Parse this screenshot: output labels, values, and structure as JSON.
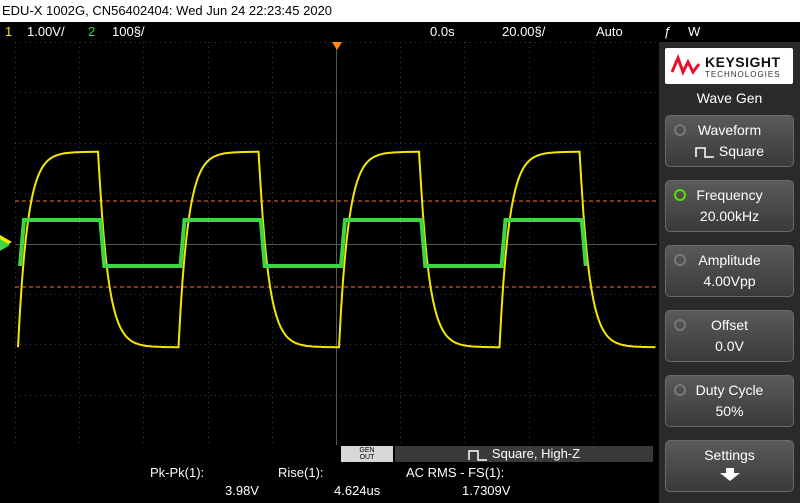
{
  "titlebar": {
    "text": "EDU-X 1002G, CN56402404: Wed Jun 24 22:23:45 2020"
  },
  "status": {
    "ch1_num": "1",
    "ch1_scale": "1.00V/",
    "ch2_num": "2",
    "ch2_scale": "100§/",
    "time_delay": "0.0s",
    "time_scale": "20.00§/",
    "trigger_mode": "Auto",
    "trigger_symbol": "ƒ",
    "trigger_source": "W"
  },
  "brand": {
    "name": "KEYSIGHT",
    "sub": "TECHNOLOGIES"
  },
  "menu": {
    "title": "Wave Gen",
    "keys": [
      {
        "label": "Waveform",
        "value": "Square",
        "active": false
      },
      {
        "label": "Frequency",
        "value": "20.00kHz",
        "active": true
      },
      {
        "label": "Amplitude",
        "value": "4.00Vpp",
        "active": false
      },
      {
        "label": "Offset",
        "value": "0.0V",
        "active": false
      },
      {
        "label": "Duty Cycle",
        "value": "50%",
        "active": false
      },
      {
        "label": "Settings",
        "value": "",
        "active": false
      }
    ]
  },
  "gen": {
    "button_line1": "GEN",
    "button_line2": "OUT",
    "status": "Square, High-Z"
  },
  "measurements": [
    {
      "label": "Pk-Pk(1):",
      "value": "3.98V"
    },
    {
      "label": "Rise(1):",
      "value": "4.624us"
    },
    {
      "label": "AC RMS - FS(1):",
      "value": "1.7309V"
    }
  ],
  "colors": {
    "ch1": "#f5e600",
    "ch2": "#3bd641",
    "cursor": "#ff6a3d",
    "accent": "#58e000"
  },
  "chart_data": {
    "type": "line",
    "series": [
      {
        "channel": "1",
        "waveform": "square",
        "high": 2.0,
        "low": -2.0,
        "periods_on_screen": 4
      },
      {
        "channel": "2",
        "waveform": "square",
        "high": 1.0,
        "low": -0.5,
        "periods_on_screen": 4
      }
    ],
    "grid": true
  }
}
